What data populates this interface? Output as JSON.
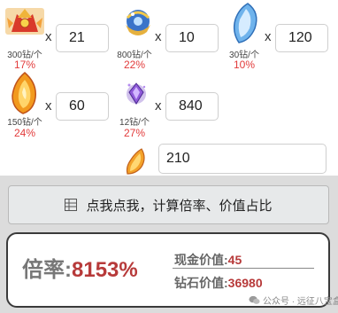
{
  "items": [
    {
      "icon": "red-gold-chest-icon",
      "price": "300钻/个",
      "percent": "17%",
      "quantity": "21"
    },
    {
      "icon": "blue-gold-ornament-icon",
      "price": "800钻/个",
      "percent": "22%",
      "quantity": "10"
    },
    {
      "icon": "blue-crystal-shard-icon",
      "price": "30钻/个",
      "percent": "10%",
      "quantity": "120"
    },
    {
      "icon": "orange-flame-crystal-icon",
      "price": "150钻/个",
      "percent": "24%",
      "quantity": "60"
    },
    {
      "icon": "purple-gem-icon",
      "price": "12钻/个",
      "percent": "27%",
      "quantity": "840"
    },
    {
      "icon": "orange-feather-icon",
      "price": "",
      "percent": "",
      "quantity": "210"
    }
  ],
  "multiply_symbol": "x",
  "calc_button": {
    "icon": "table-grid-icon",
    "label": "点我点我，计算倍率、价值占比"
  },
  "result": {
    "rate_label": "倍率:",
    "rate_value": "8153%",
    "cash_label": "现金价值:",
    "cash_value": "45",
    "diamond_label": "钻石价值:",
    "diamond_value": "36980"
  },
  "watermark": {
    "icon": "wechat-icon",
    "text": "公众号 · 远征八宝盒"
  },
  "colors": {
    "accent_red": "#e23b3b",
    "value_red": "#b73a3a",
    "band_gray": "#dcdcdc"
  }
}
